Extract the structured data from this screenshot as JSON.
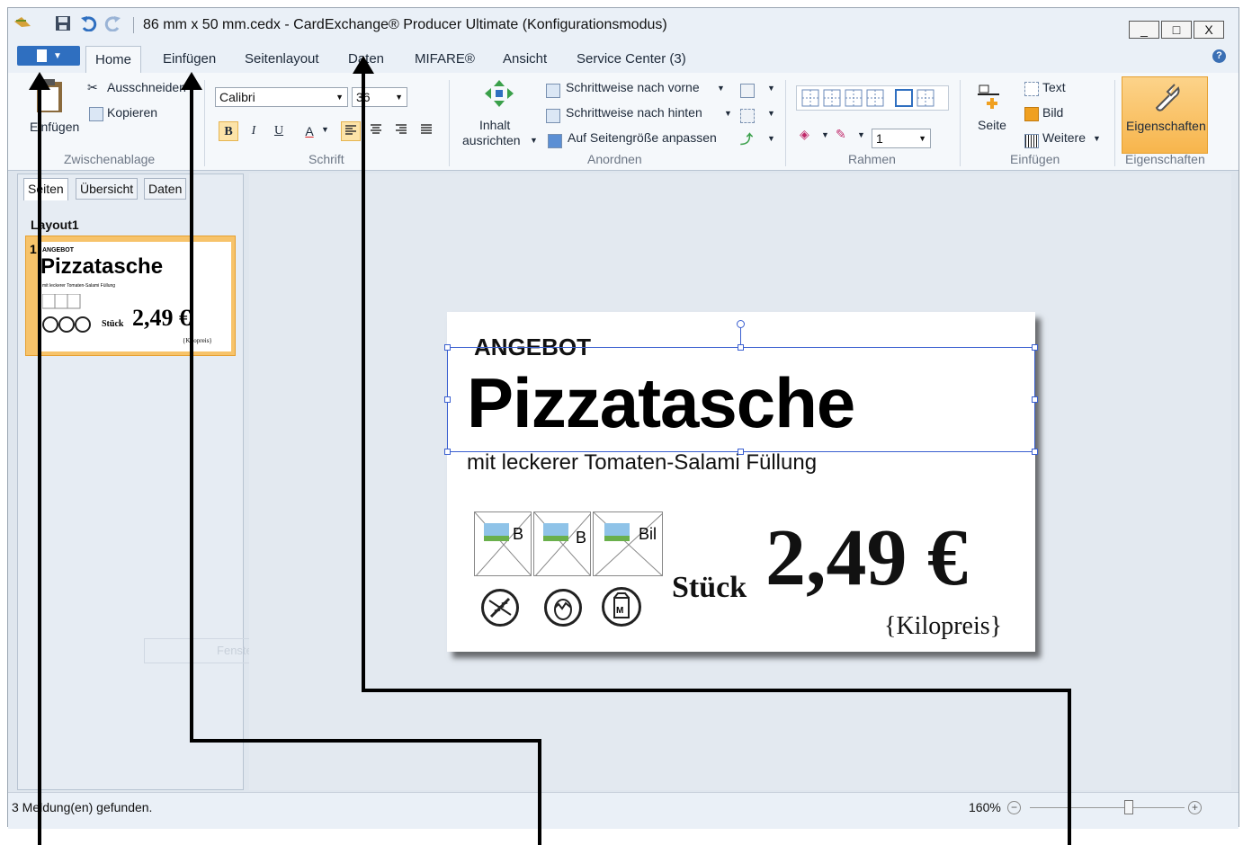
{
  "window": {
    "title": "86 mm x 50 mm.cedx - CardExchange® Producer Ultimate (Konfigurationsmodus)",
    "minimize": "_",
    "maximize": "□",
    "close": "X"
  },
  "tabs": {
    "home": "Home",
    "einfuegen": "Einfügen",
    "seitenlayout": "Seitenlayout",
    "daten": "Daten",
    "mifare": "MIFARE®",
    "ansicht": "Ansicht",
    "service": "Service Center (3)"
  },
  "ribbon": {
    "clipboard": {
      "paste": "Einfügen",
      "cut": "Ausschneiden",
      "copy": "Kopieren",
      "group": "Zwischenablage"
    },
    "font": {
      "family": "Calibri",
      "size": "36",
      "bold": "B",
      "italic": "I",
      "underline": "U",
      "color": "A",
      "group": "Schrift"
    },
    "arrange": {
      "align_content_1": "Inhalt",
      "align_content_2": "ausrichten",
      "forward": "Schrittweise nach vorne",
      "backward": "Schrittweise nach hinten",
      "fit": "Auf Seitengröße anpassen",
      "group": "Anordnen"
    },
    "frame": {
      "width": "1",
      "group": "Rahmen"
    },
    "insert": {
      "page": "Seite",
      "text": "Text",
      "image": "Bild",
      "more": "Weitere",
      "group": "Einfügen"
    },
    "properties": {
      "button": "Eigenschaften",
      "group": "Eigenschaften"
    }
  },
  "left_panel": {
    "tabs": [
      "Seiten",
      "Übersicht",
      "Daten"
    ],
    "layout_label": "Layout1",
    "page_number": "1",
    "ghost_text": "Fenster ausschneiden"
  },
  "card": {
    "eyebrow": "ANGEBOT",
    "title": "Pizzatasche",
    "subtitle": "mit leckerer Tomaten-Salami Füllung",
    "unit": "Stück",
    "price": "2,49 €",
    "kilo_price": "{Kilopreis}",
    "image_labels": [
      "B",
      "B",
      "Bil"
    ]
  },
  "thumbnail": {
    "eyebrow": "ANGEBOT",
    "title": "Pizzatasche",
    "subtitle": "mit leckerer Tomaten-Salami Füllung",
    "unit": "Stück",
    "price": "2,49 €",
    "kilo_price": "{Kilopreis}"
  },
  "status": {
    "message": "3 Meldung(en) gefunden.",
    "zoom": "160%",
    "zoom_fraction": 0.64
  },
  "colors": {
    "accent_blue": "#2f6fc0",
    "highlight_orange": "#f7b54c",
    "selection": "#3a5fd0"
  }
}
